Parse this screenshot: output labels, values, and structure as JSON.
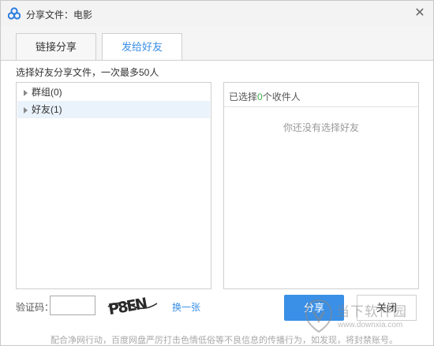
{
  "window": {
    "title": "分享文件：电影"
  },
  "tabs": [
    {
      "label": "链接分享",
      "active": false
    },
    {
      "label": "发给好友",
      "active": true
    }
  ],
  "instruction": "选择好友分享文件，一次最多50人",
  "contacts": {
    "tree": [
      {
        "label": "群组(0)"
      },
      {
        "label": "好友(1)"
      }
    ]
  },
  "selection": {
    "prefix": "已选择",
    "count": "0",
    "suffix": "个收件人",
    "empty_message": "你还没有选择好友"
  },
  "captcha": {
    "label": "验证码：",
    "value": "",
    "image_text": "P8EN",
    "refresh_label": "换一张"
  },
  "buttons": {
    "share": "分享",
    "cancel": "关闭"
  },
  "footer_note": "配合净网行动，百度网盘严厉打击色情低俗等不良信息的传播行为，如发现，将封禁账号。",
  "watermark": {
    "title": "当下软件园",
    "url": "www.downxia.com"
  },
  "colors": {
    "accent": "#3a8fe6",
    "count_green": "#3cb34a",
    "title_bar": "#f3f3f3"
  }
}
